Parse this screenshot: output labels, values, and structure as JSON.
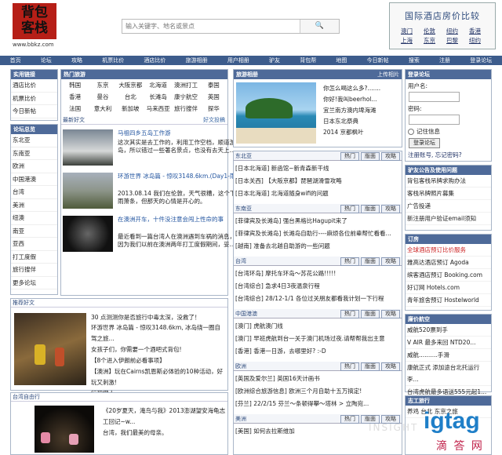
{
  "logo": {
    "line1": "背包",
    "line2": "客栈",
    "url": "www.bbkz.com"
  },
  "search": {
    "placeholder": "输入关键字、地名或景点",
    "button": "🔍"
  },
  "hotel_compare": {
    "title": "国际酒店房价比较",
    "cities": [
      "澳门",
      "伦敦",
      "纽约",
      "香港",
      "上海",
      "东京",
      "巴黎",
      "纽约"
    ]
  },
  "nav": [
    "首页",
    "论坛",
    "攻略",
    "机票比价",
    "酒店比价",
    "旅游相册",
    "用户相册",
    "驴友",
    "背包帮",
    "地图",
    "今日新帖",
    "搜索",
    "注册",
    "登录论坛"
  ],
  "links": {
    "title": "实用链接",
    "items": [
      "酒店比价",
      "机票比价",
      "今日新帖"
    ]
  },
  "forums": {
    "title": "论坛总览",
    "items": [
      "东北亚",
      "东南亚",
      "欧洲",
      "中国港澳",
      "台湾",
      "美洲",
      "纽澳",
      "南亚",
      "亚西",
      "打工度假",
      "旅行搜伴",
      "更多论坛"
    ]
  },
  "hot_countries": {
    "title": "热门旅游",
    "items": [
      "韩国",
      "东京",
      "大阪京都",
      "北海道",
      "澳洲打工",
      "泰国",
      "香港",
      "曼谷",
      "台北",
      "长滩岛",
      "康宁航空",
      "英国",
      "法国",
      "意大利",
      "新加坡",
      "马来西亚",
      "旅行搜伴",
      "探华"
    ]
  },
  "latest": {
    "title": "最新好文",
    "more": "好文投稿",
    "articles": [
      {
        "title": "马祖四乡五岛工作游",
        "text": "这次其实是去工作的，利用工作空档，顺道游玩一下马祖四乡五岛，所以错过一些著名景点，也没有去天上..."
      },
      {
        "title": "环游世界 冰岛篇 - 惊叹3148.6km.(Day1-雨后彩虹)",
        "text": "2013.08.14 我们在伦敦，天气很糟，这个下雨的日子。虽然冷雨萧条，但那天的心情是开心的。"
      },
      {
        "title": "在澳洲开车，十件没注意会闯上性命的事",
        "text": "最近看到一篇台湾人在澳洲遇到车祸的消息，让人心有戚戚焉，因为我们以前在澳洲两年打工度假期间，妥..."
      }
    ]
  },
  "recommended": {
    "title": "推荐好文",
    "lead": "30 点测测你是否旅行中毒太深，没救了！",
    "lines": [
      "环游世界 冰岛篇 - 惊叹3148.6km, 冰岛绕一圈自驾之旅...",
      "女孩子们，你需要一个酒吧式背包!",
      "【8个进入伊朗前必看事项】",
      "【澳洲】玩在Cairns凯恩斯必体验的10种活动，好玩又刺激!",
      "行程懒人..."
    ]
  },
  "taiwan": {
    "title": "台湾自由行",
    "lines": [
      "《20岁夏天，淹鸟与我》2013澎湖望安海龟志工回记~w...",
      "台湾，我们最美的母亲。"
    ]
  },
  "album": {
    "title": "旅游相册",
    "more": "上传相片",
    "items": [
      "你怎么喝这么多?.......",
      "你好!我叫beerhol...",
      "宜兰南方澳内埤海滩",
      "日本东北祭典",
      "2014 京都枫叶"
    ]
  },
  "sections": [
    {
      "title": "东北亚",
      "tabs": [
        "热门",
        "版面",
        "攻略"
      ],
      "lines": [
        "[日本北海道] 新函馆~新青森新干线",
        "[日本关西] 【大阪京都】琵琶湖滑雪攻略",
        "[日本北海道] 北海道随身wifi的问题"
      ]
    },
    {
      "title": "东南亚",
      "tabs": [
        "热门",
        "版面",
        "攻略"
      ],
      "lines": [
        "[菲律宾及长滩岛] 强台黑格比Hagupit来了",
        "[菲律宾及长滩岛] 长滩岛自助行----麻烦各位前辈帮忙看看...",
        "[越南] 准备去北越自助游的一些问题"
      ]
    },
    {
      "title": "台湾",
      "tabs": [
        "热门",
        "版面",
        "攻略"
      ],
      "lines": [
        "[台湾环岛] 摩托车环岛～苏花公路!!!!!",
        "[台湾综合] 急求4日3夜温泉行程",
        "[台湾综合] 28/12-1/1 各位过关朋友都看我计划一下行程"
      ]
    },
    {
      "title": "中国港澳",
      "tabs": [
        "热门",
        "版面",
        "攻略"
      ],
      "lines": [
        "[澳门] 虎航澳门线",
        "[澳门] 早班虎航到台一关于澳门机场过夜.请帮帮我出主意",
        "[香港] 香港一日游，去哪里好? :-D"
      ]
    },
    {
      "title": "欧洲",
      "tabs": [
        "热门",
        "版面",
        "攻略"
      ],
      "lines": [
        "[英国及爱尔兰] 英国16天计画书",
        "[欧洲综合旅游信息] 欧洲三个月自助十五万搞定!",
        "[芬兰] 22/2/15 芬兰～条顿得攀～塔林 > 立陶宛..."
      ]
    },
    {
      "title": "美洲",
      "tabs": [
        "热门",
        "版面",
        "攻略"
      ],
      "lines": [
        "[美国] 如何去拉斯维加"
      ]
    }
  ],
  "login": {
    "title": "登录论坛",
    "user_label": "用户名:",
    "pass_label": "密码:",
    "remember": "记住信息",
    "button": "登录论坛",
    "links": "注册账号, 忘记密码?"
  },
  "travel_issues": {
    "title": "驴友公告及使用问题",
    "items": [
      "背包客栈吊牌求购办法",
      "客栈吊牌照片募集",
      "广告投递",
      "新注册用户验证email须知"
    ]
  },
  "booking": {
    "title": "订房",
    "items": [
      "全球酒店预订比价服务",
      "雅高达酒店预订 Agoda",
      "缤客酒店预订 Booking.com",
      "好订网 Hotels.com",
      "青年旅舍预订 Hostelworld"
    ]
  },
  "cheap_air": {
    "title": "廉价航空",
    "items": [
      "威航520票到手",
      "V AIR 最多来回 NTD20...",
      "威航..........手滑",
      "康航正式 添加途台北托运行李...",
      "台湾虎航最多语送555元起1..."
    ]
  },
  "volunteer": {
    "title": "志工旅行",
    "items": [
      "养鸡 台北 东京之旅"
    ]
  },
  "watermark": {
    "brand": "igtag",
    "sub": "INSIGHT",
    "cn": "滴 答 网"
  }
}
